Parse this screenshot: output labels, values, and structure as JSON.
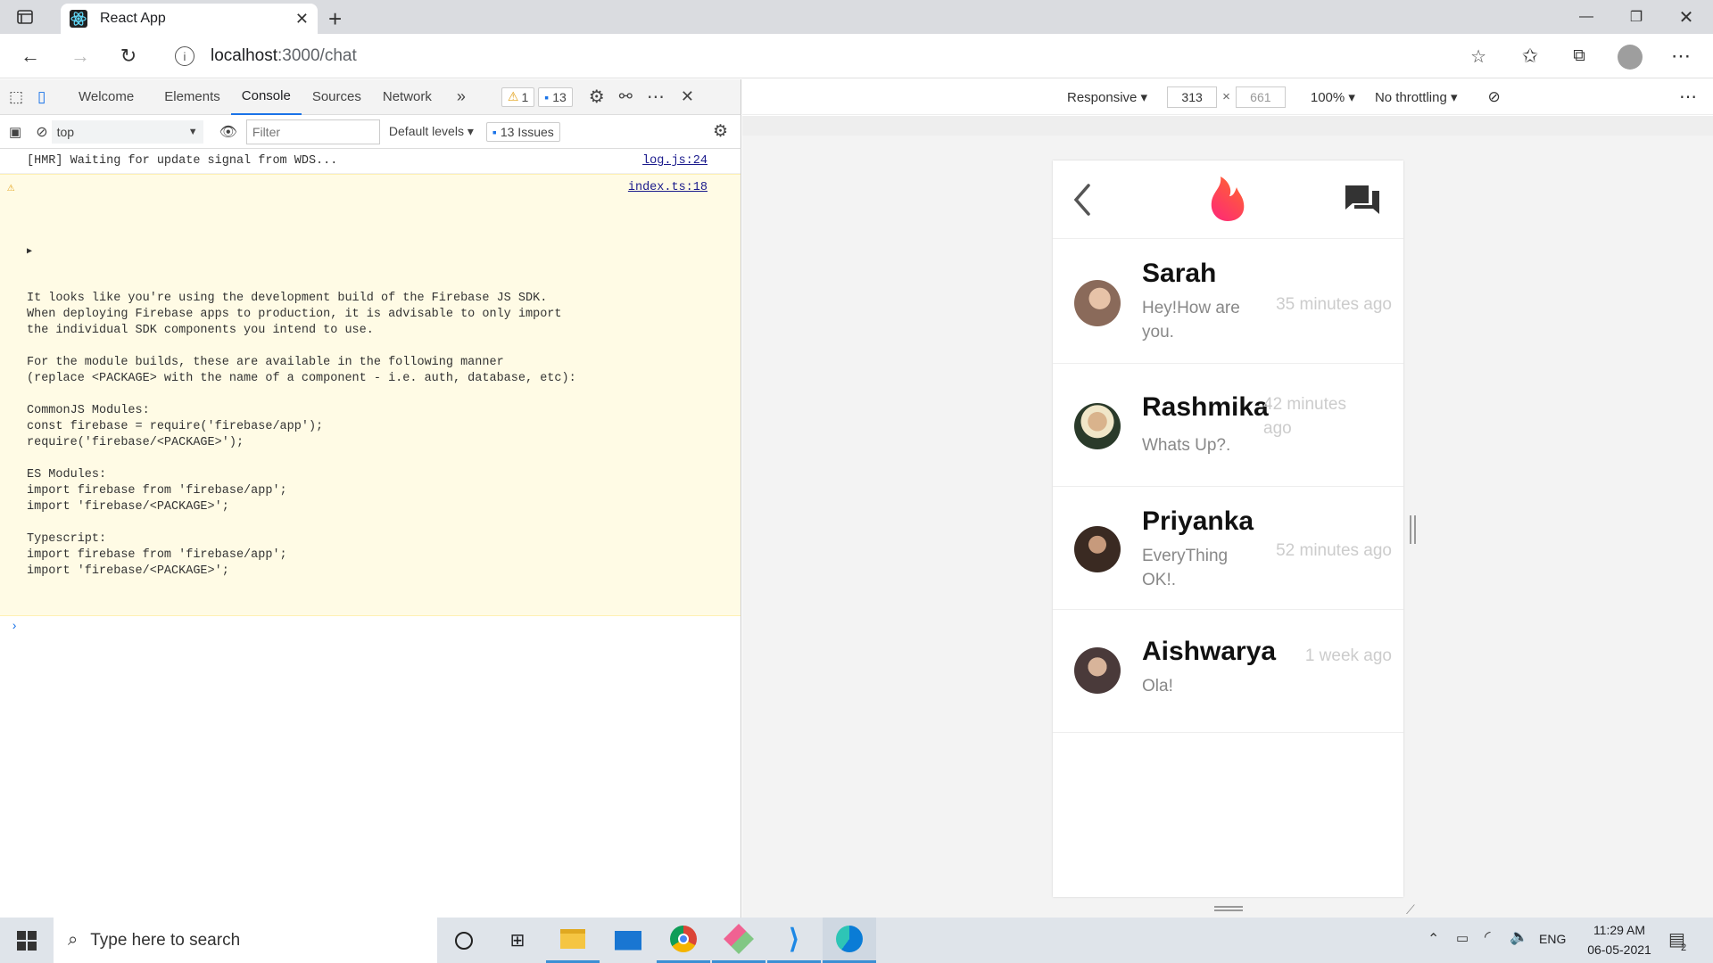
{
  "browser": {
    "tab_title": "React App",
    "url_host": "localhost",
    "url_path": ":3000/chat"
  },
  "devtools": {
    "tabs": [
      "Welcome",
      "Elements",
      "Console",
      "Sources",
      "Network"
    ],
    "warning_count": "1",
    "message_count": "13",
    "context": "top",
    "filter_placeholder": "Filter",
    "levels": "Default levels",
    "issues": "13 Issues",
    "logs": [
      {
        "text": "[HMR] Waiting for update signal from WDS...",
        "source": "log.js:24"
      }
    ],
    "warning": {
      "source": "index.ts:18",
      "text": "It looks like you're using the development build of the Firebase JS SDK.\nWhen deploying Firebase apps to production, it is advisable to only import\nthe individual SDK components you intend to use.\n\nFor the module builds, these are available in the following manner\n(replace <PACKAGE> with the name of a component - i.e. auth, database, etc):\n\nCommonJS Modules:\nconst firebase = require('firebase/app');\nrequire('firebase/<PACKAGE>');\n\nES Modules:\nimport firebase from 'firebase/app';\nimport 'firebase/<PACKAGE>';\n\nTypescript:\nimport firebase from 'firebase/app';\nimport 'firebase/<PACKAGE>';"
    }
  },
  "device_toolbar": {
    "mode": "Responsive",
    "width": "313",
    "height": "661",
    "zoom": "100%",
    "throttling": "No throttling"
  },
  "chats": [
    {
      "name": "Sarah",
      "message": "Hey!How are you.",
      "time": "35 minutes ago",
      "avatar_color": "#8a6a5a"
    },
    {
      "name": "Rashmika",
      "message": "Whats Up?.",
      "time": "42 minutes ago",
      "avatar_color": "#6d5a3a"
    },
    {
      "name": "Priyanka",
      "message": "EveryThing OK!.",
      "time": "52 minutes ago",
      "avatar_color": "#3a2a22"
    },
    {
      "name": "Aishwarya",
      "message": "Ola!",
      "time": "1 week ago",
      "avatar_color": "#4a3a3a"
    }
  ],
  "colors": {
    "accent_flame": "#fd4c5c",
    "devtools_blue": "#1a73e8"
  },
  "taskbar": {
    "search_placeholder": "Type here to search",
    "language": "ENG",
    "time": "11:29 AM",
    "date": "06-05-2021",
    "notifications": "2"
  }
}
